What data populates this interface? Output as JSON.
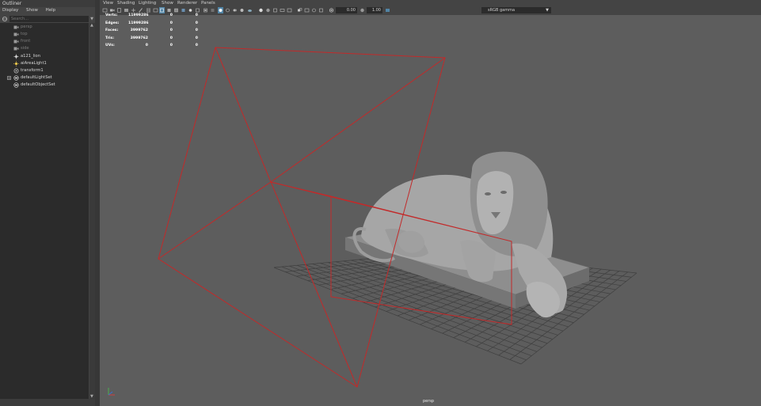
{
  "outliner": {
    "title": "Outliner",
    "menu": [
      "Display",
      "Show",
      "Help"
    ],
    "search_placeholder": "Search...",
    "items": [
      {
        "label": "persp",
        "icon": "camera-icon",
        "dim": true
      },
      {
        "label": "top",
        "icon": "camera-icon",
        "dim": true
      },
      {
        "label": "front",
        "icon": "camera-icon",
        "dim": true
      },
      {
        "label": "side",
        "icon": "camera-icon",
        "dim": true
      },
      {
        "label": "a121_lion",
        "icon": "mesh-transform-icon",
        "dim": false
      },
      {
        "label": "aiAreaLight1",
        "icon": "light-icon",
        "dim": false
      },
      {
        "label": "transform1",
        "icon": "transform-icon",
        "dim": false
      },
      {
        "label": "defaultLightSet",
        "icon": "set-icon",
        "dim": false
      },
      {
        "label": "defaultObjectSet",
        "icon": "set-icon",
        "dim": false
      }
    ]
  },
  "viewport": {
    "menu": [
      "View",
      "Shading",
      "Lighting",
      "Show",
      "Renderer",
      "Panels"
    ],
    "exposure": "0.00",
    "gamma": "1.00",
    "color_management": "sRGB gamma",
    "camera_label": "persp",
    "hud": {
      "rows": [
        {
          "label": "Verts:",
          "total": "11999286",
          "selected": "0",
          "components": "0"
        },
        {
          "label": "Edges:",
          "total": "11999286",
          "selected": "0",
          "components": "0"
        },
        {
          "label": "Faces:",
          "total": "3999762",
          "selected": "0",
          "components": "0"
        },
        {
          "label": "Tris:",
          "total": "3999762",
          "selected": "0",
          "components": "0"
        },
        {
          "label": "UVs:",
          "total": "0",
          "selected": "0",
          "components": "0"
        }
      ]
    }
  },
  "colors": {
    "viewport_bg": "#5d5d5d",
    "grid": "#3f3f3f",
    "light_outline": "#c22a2a",
    "selection_blue": "#5285a6",
    "model_gray": "#9a9a9a"
  }
}
